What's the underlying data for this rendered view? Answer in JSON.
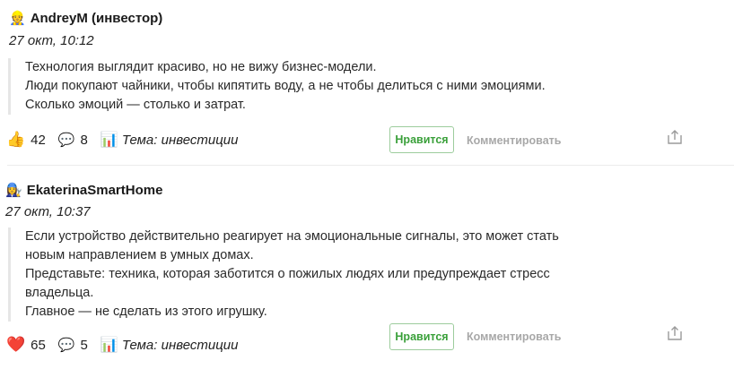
{
  "comments": [
    {
      "author_emoji": "👷",
      "author": "AndreyM (инвестор)",
      "time": "27 окт, 10:12",
      "lines": [
        "Технология выглядит красиво, но не вижу бизнес-модели.",
        "Люди покупают чайники, чтобы кипятить воду, а не чтобы делиться с ними эмоциями.",
        "Сколько эмоций — столько и затрат."
      ],
      "reaction_icon": "👍",
      "reaction_icon_name": "thumbs-up-icon",
      "reactions": "42",
      "comment_icon": "💬",
      "comments_count": "8",
      "topic_icon": "📊",
      "topic": "Тема: инвестиции",
      "like_label": "Нравится",
      "comment_label": "Комментировать"
    },
    {
      "author_emoji": "👩‍🔧",
      "author": "EkaterinaSmartHome",
      "time": "27 окт, 10:37",
      "lines": [
        "Если устройство действительно реагирует на эмоциональные сигналы, это может стать",
        "новым направлением в умных домах.",
        "Представьте: техника, которая заботится о пожилых людях или предупреждает стресс",
        "владельца.",
        "Главное — не сделать из этого игрушку."
      ],
      "reaction_icon": "❤️",
      "reaction_icon_name": "heart-icon",
      "reactions": "65",
      "comment_icon": "💬",
      "comments_count": "5",
      "topic_icon": "📊",
      "topic": "Тема: инвестиции",
      "like_label": "Нравится",
      "comment_label": "Комментировать"
    }
  ],
  "colors": {
    "like_button_border": "#9ccc9c",
    "like_button_text": "#3aa03a",
    "muted_action": "#a8a8a8",
    "quote_border": "#e6e6e6"
  }
}
